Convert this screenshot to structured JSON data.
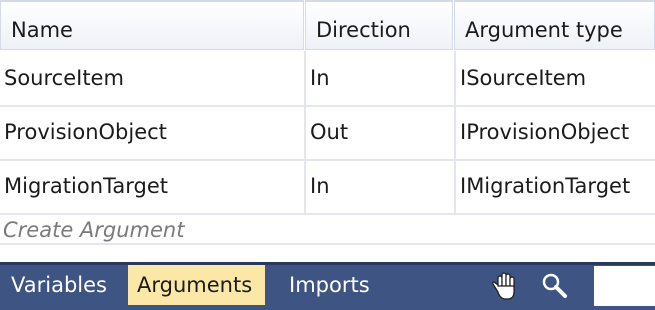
{
  "grid": {
    "columns": {
      "name": "Name",
      "direction": "Direction",
      "argument_type": "Argument type"
    },
    "rows": [
      {
        "name": "SourceItem",
        "direction": "In",
        "argument_type": "ISourceItem"
      },
      {
        "name": "ProvisionObject",
        "direction": "Out",
        "argument_type": "IProvisionObject"
      },
      {
        "name": "MigrationTarget",
        "direction": "In",
        "argument_type": "IMigrationTarget"
      }
    ],
    "create_label": "Create Argument"
  },
  "bottom_bar": {
    "tabs": {
      "variables": "Variables",
      "arguments": "Arguments",
      "imports": "Imports"
    },
    "active_tab": "arguments",
    "icons": [
      "pan-hand-icon",
      "search-icon"
    ],
    "zoom_value": ""
  },
  "colors": {
    "bar_background": "#3e5482",
    "active_tab": "#fbe8a6",
    "placeholder_text": "#7a7a7a"
  }
}
